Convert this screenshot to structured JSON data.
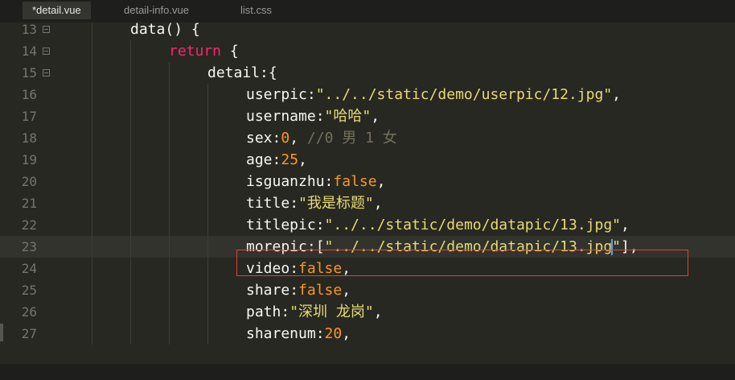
{
  "tabs": [
    {
      "label": "*detail.vue",
      "active": true
    },
    {
      "label": "detail-info.vue",
      "active": false
    },
    {
      "label": "list.css",
      "active": false
    }
  ],
  "lines": [
    {
      "num": "13",
      "indent": 2,
      "fold": true,
      "tokens": [
        {
          "t": "data",
          "c": "t-plain"
        },
        {
          "t": "() {",
          "c": "t-plain"
        }
      ]
    },
    {
      "num": "14",
      "indent": 3,
      "fold": true,
      "tokens": [
        {
          "t": "return",
          "c": "t-kw"
        },
        {
          "t": " {",
          "c": "t-plain"
        }
      ]
    },
    {
      "num": "15",
      "indent": 4,
      "fold": true,
      "tokens": [
        {
          "t": "detail",
          "c": "t-key"
        },
        {
          "t": ":{",
          "c": "t-plain"
        }
      ]
    },
    {
      "num": "16",
      "indent": 5,
      "tokens": [
        {
          "t": "userpic",
          "c": "t-key"
        },
        {
          "t": ":",
          "c": "t-plain"
        },
        {
          "t": "\"../../static/demo/userpic/12.jpg\"",
          "c": "t-str"
        },
        {
          "t": ",",
          "c": "t-plain"
        }
      ]
    },
    {
      "num": "17",
      "indent": 5,
      "tokens": [
        {
          "t": "username",
          "c": "t-key"
        },
        {
          "t": ":",
          "c": "t-plain"
        },
        {
          "t": "\"哈哈\"",
          "c": "t-str"
        },
        {
          "t": ",",
          "c": "t-plain"
        }
      ]
    },
    {
      "num": "18",
      "indent": 5,
      "tokens": [
        {
          "t": "sex",
          "c": "t-key"
        },
        {
          "t": ":",
          "c": "t-plain"
        },
        {
          "t": "0",
          "c": "t-bool"
        },
        {
          "t": ", ",
          "c": "t-plain"
        },
        {
          "t": "//0 男 1 女",
          "c": "t-cmt"
        }
      ]
    },
    {
      "num": "19",
      "indent": 5,
      "tokens": [
        {
          "t": "age",
          "c": "t-key"
        },
        {
          "t": ":",
          "c": "t-plain"
        },
        {
          "t": "25",
          "c": "t-bool"
        },
        {
          "t": ",",
          "c": "t-plain"
        }
      ]
    },
    {
      "num": "20",
      "indent": 5,
      "tokens": [
        {
          "t": "isguanzhu",
          "c": "t-key"
        },
        {
          "t": ":",
          "c": "t-plain"
        },
        {
          "t": "false",
          "c": "t-bool"
        },
        {
          "t": ",",
          "c": "t-plain"
        }
      ]
    },
    {
      "num": "21",
      "indent": 5,
      "tokens": [
        {
          "t": "title",
          "c": "t-key"
        },
        {
          "t": ":",
          "c": "t-plain"
        },
        {
          "t": "\"我是标题\"",
          "c": "t-str"
        },
        {
          "t": ",",
          "c": "t-plain"
        }
      ]
    },
    {
      "num": "22",
      "indent": 5,
      "tokens": [
        {
          "t": "titlepic",
          "c": "t-key"
        },
        {
          "t": ":",
          "c": "t-plain"
        },
        {
          "t": "\"../../static/demo/datapic/13.jpg\"",
          "c": "t-str"
        },
        {
          "t": ",",
          "c": "t-plain"
        }
      ]
    },
    {
      "num": "23",
      "indent": 5,
      "current": true,
      "tokens": [
        {
          "t": "morepic",
          "c": "t-key"
        },
        {
          "t": ":[",
          "c": "t-plain"
        },
        {
          "t": "\"../../static/demo/datapic/13.jpg",
          "c": "t-str"
        },
        {
          "cursor": true
        },
        {
          "t": "\"",
          "c": "t-str"
        },
        {
          "t": "],",
          "c": "t-plain"
        }
      ]
    },
    {
      "num": "24",
      "indent": 5,
      "tokens": [
        {
          "t": "video",
          "c": "t-key"
        },
        {
          "t": ":",
          "c": "t-plain"
        },
        {
          "t": "false",
          "c": "t-bool"
        },
        {
          "t": ",",
          "c": "t-plain"
        }
      ]
    },
    {
      "num": "25",
      "indent": 5,
      "tokens": [
        {
          "t": "share",
          "c": "t-key"
        },
        {
          "t": ":",
          "c": "t-plain"
        },
        {
          "t": "false",
          "c": "t-bool"
        },
        {
          "t": ",",
          "c": "t-plain"
        }
      ]
    },
    {
      "num": "26",
      "indent": 5,
      "tokens": [
        {
          "t": "path",
          "c": "t-key"
        },
        {
          "t": ":",
          "c": "t-plain"
        },
        {
          "t": "\"深圳 龙岗\"",
          "c": "t-str"
        },
        {
          "t": ",",
          "c": "t-plain"
        }
      ]
    },
    {
      "num": "27",
      "indent": 5,
      "tokens": [
        {
          "t": "sharenum",
          "c": "t-key"
        },
        {
          "t": ":",
          "c": "t-plain"
        },
        {
          "t": "20",
          "c": "t-bool"
        },
        {
          "t": ",",
          "c": "t-plain"
        }
      ]
    }
  ],
  "colors": {
    "background": "#272822",
    "string": "#e6db74",
    "keyword": "#f92672",
    "number": "#fd971f",
    "comment": "#75715e",
    "highlight_box": "#e0403c",
    "cursor": "#5b9bff"
  }
}
